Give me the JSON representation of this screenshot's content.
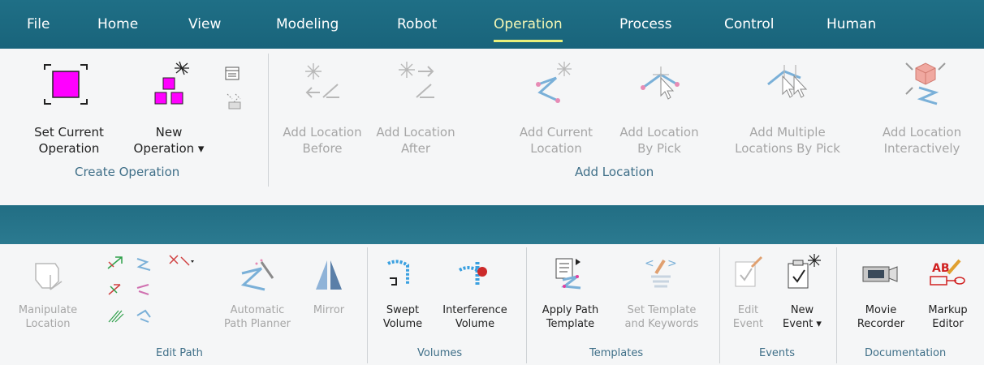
{
  "tabs": [
    "File",
    "Home",
    "View",
    "Modeling",
    "Robot",
    "Operation",
    "Process",
    "Control",
    "Human"
  ],
  "active_tab": "Operation",
  "ribbon_top": {
    "set_current_operation": [
      "Set Current",
      "Operation"
    ],
    "new_operation": [
      "New",
      "Operation ▾"
    ],
    "group_create": "Create Operation",
    "add_before": [
      "Add Location",
      "Before"
    ],
    "add_after": [
      "Add Location",
      "After"
    ],
    "add_current": [
      "Add Current",
      "Location"
    ],
    "add_by_pick": [
      "Add Location",
      "By Pick"
    ],
    "add_multiple": [
      "Add Multiple",
      "Locations By Pick"
    ],
    "add_interactively": [
      "Add Location",
      "Interactively"
    ],
    "group_add": "Add Location"
  },
  "ribbon_bottom": {
    "manipulate": [
      "Manipulate",
      "Location"
    ],
    "automatic": [
      "Automatic",
      "Path Planner"
    ],
    "mirror": "Mirror",
    "group_edit": "Edit Path",
    "swept": [
      "Swept",
      "Volume"
    ],
    "interference": [
      "Interference",
      "Volume"
    ],
    "group_volumes": "Volumes",
    "apply_template": [
      "Apply Path",
      "Template"
    ],
    "set_template": [
      "Set Template",
      "and Keywords"
    ],
    "group_templates": "Templates",
    "edit_event": [
      "Edit",
      "Event"
    ],
    "new_event": [
      "New",
      "Event ▾"
    ],
    "group_events": "Events",
    "movie": [
      "Movie",
      "Recorder"
    ],
    "markup": [
      "Markup",
      "Editor"
    ],
    "group_doc": "Documentation"
  },
  "colors": {
    "tabbar": "#1f6f86",
    "active_tab_text": "#f3f6b5",
    "group_label": "#3f6f88",
    "disabled": "#a6a6a6",
    "magenta": "#ff00ff"
  }
}
